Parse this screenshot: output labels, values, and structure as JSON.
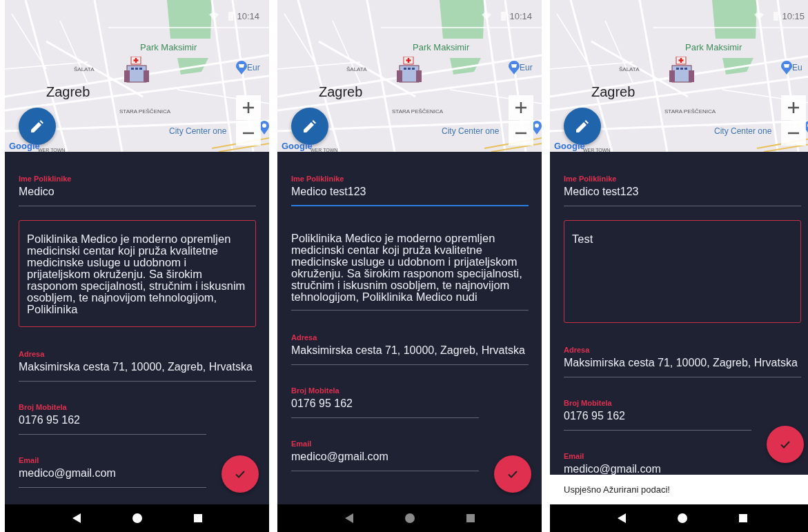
{
  "screens": [
    {
      "status_bar": {
        "time": "10:14"
      },
      "map": {
        "labels": [
          {
            "kind": "park",
            "text": "Park Maksimir"
          },
          {
            "kind": "district",
            "text": "ŠALATA"
          },
          {
            "kind": "city",
            "text": "Zagreb"
          },
          {
            "kind": "district2",
            "text": "STARA PEŠČENICA"
          },
          {
            "kind": "place",
            "text": "City Center one"
          },
          {
            "kind": "shop",
            "text": "Eur"
          },
          {
            "kind": "logo",
            "text": "Google"
          },
          {
            "kind": "footer",
            "text": "WER TOWN"
          }
        ]
      },
      "fields": [
        {
          "kind": "line",
          "label": "Ime Poliklinike",
          "value": "Medico",
          "focused": false
        },
        {
          "kind": "area",
          "value": "Poliklinika Medico je moderno opremljen medicinski centar koji pruža kvalitetne medicinske usluge u udobnom i prijateljskom okruženju. Sa širokim rasponom specijalnosti, stručnim i iskusnim osobljem, te najnovijom tehnologijom, Poliklinika",
          "outlined": true
        },
        {
          "kind": "line",
          "label": "Adresa",
          "value": "Maksimirska cesta 71, 10000, Zagreb, Hrvatska",
          "focused": false
        },
        {
          "kind": "line",
          "label": "Broj Mobitela",
          "value": "0176 95 162",
          "focused": false
        },
        {
          "kind": "line",
          "label": "Email",
          "value": "medico@gmail.com",
          "focused": false
        }
      ],
      "nav_dimmed": false
    },
    {
      "status_bar": {
        "time": "10:14"
      },
      "map": {
        "labels": [
          {
            "kind": "park",
            "text": "Park Maksimir"
          },
          {
            "kind": "district",
            "text": "ŠALATA"
          },
          {
            "kind": "city",
            "text": "Zagreb"
          },
          {
            "kind": "district2",
            "text": "STARA PEŠČENICA"
          },
          {
            "kind": "place",
            "text": "City Center one"
          },
          {
            "kind": "shop",
            "text": "Eur"
          },
          {
            "kind": "logo",
            "text": "Google"
          },
          {
            "kind": "footer",
            "text": "WER TOWN"
          }
        ]
      },
      "fields": [
        {
          "kind": "line",
          "label": "Ime Poliklinike",
          "value": "Medico test123",
          "focused": true
        },
        {
          "kind": "area",
          "value": "Poliklinika Medico je moderno opremljen medicinski centar koji pruža kvalitetne medicinske usluge u udobnom i prijateljskom okruženju. Sa širokim rasponom specijalnosti, stručnim i iskusnim osobljem, te najnovijom tehnologijom, Poliklinika Medico nudi",
          "outlined": false
        },
        {
          "kind": "line",
          "label": "Adresa",
          "value": "Maksimirska cesta 71, 10000, Zagreb, Hrvatska",
          "focused": false
        },
        {
          "kind": "line",
          "label": "Broj Mobitela",
          "value": "0176 95 162",
          "focused": false
        },
        {
          "kind": "line",
          "label": "Email",
          "value": "medico@gmail.com",
          "focused": false
        }
      ],
      "nav_dimmed": true
    },
    {
      "status_bar": {
        "time": "10:15"
      },
      "map": {
        "labels": [
          {
            "kind": "park",
            "text": "Park Maksimir"
          },
          {
            "kind": "district",
            "text": "ŠALATA"
          },
          {
            "kind": "city",
            "text": "Zagreb"
          },
          {
            "kind": "district2",
            "text": "STARA PEŠČENICA"
          },
          {
            "kind": "place",
            "text": "City Center one"
          },
          {
            "kind": "shop",
            "text": "Eu"
          },
          {
            "kind": "logo",
            "text": "Google"
          },
          {
            "kind": "footer",
            "text": "WER TOWN"
          }
        ]
      },
      "fields": [
        {
          "kind": "line",
          "label": "Ime Poliklinike",
          "value": "Medico test123",
          "focused": false
        },
        {
          "kind": "area",
          "value": "Test",
          "outlined": true
        },
        {
          "kind": "line",
          "label": "Adresa",
          "value": "Maksimirska cesta 71, 10000, Zagreb, Hrvatska",
          "focused": false
        },
        {
          "kind": "line",
          "label": "Broj Mobitela",
          "value": "0176 95 162",
          "focused": false
        },
        {
          "kind": "line",
          "label": "Email",
          "value": "medico@gmail.com",
          "focused": false
        }
      ],
      "snackbar": {
        "text": "Uspješno Ažurirani podaci!"
      },
      "nav_dimmed": false
    }
  ]
}
